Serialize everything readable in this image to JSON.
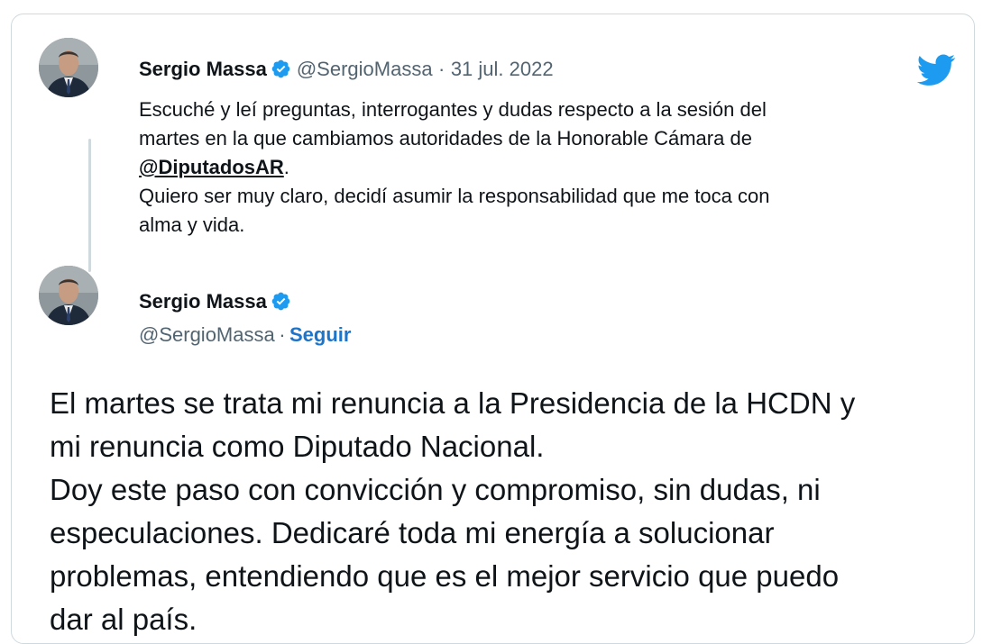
{
  "quoted_tweet": {
    "author_name": "Sergio Massa",
    "handle": "@SergioMassa",
    "separator": "·",
    "date": "31 jul. 2022",
    "line1": "Escuché y leí preguntas, interrogantes y dudas respecto a la sesión del",
    "line2": "martes en la que cambiamos autoridades de la Honorable Cámara de",
    "mention": "@DiputadosAR",
    "mention_suffix": ".",
    "line4": "Quiero ser muy claro, decidí asumir la responsabilidad que me toca con",
    "line5": "alma y vida."
  },
  "main_tweet": {
    "author_name": "Sergio Massa",
    "handle": "@SergioMassa",
    "separator": "·",
    "follow_label": "Seguir",
    "line1": "El martes se trata mi renuncia a la Presidencia de la HCDN y",
    "line2": "mi renuncia como Diputado Nacional.",
    "line3": "Doy este paso con convicción y compromiso, sin dudas, ni",
    "line4": "especulaciones. Dedicaré toda mi energía a solucionar",
    "line5": "problemas, entendiendo que es el mejor servicio que puedo",
    "line6": "dar al país."
  },
  "icons": {
    "brand": "twitter-bird-icon",
    "verified": "verified-badge-icon"
  },
  "colors": {
    "twitter_blue": "#1d9bf0",
    "follow_blue": "#1d74c9",
    "muted_gray": "#536471",
    "border": "#cfd9de"
  }
}
